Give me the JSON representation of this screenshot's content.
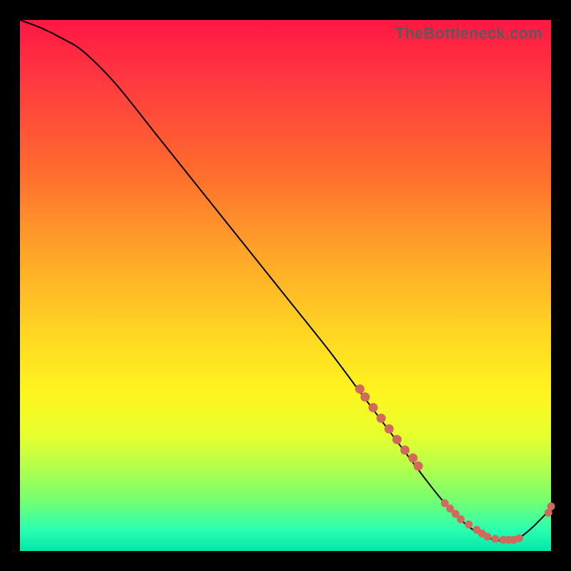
{
  "watermark": "TheBottleneck.com",
  "chart_data": {
    "type": "line",
    "title": "",
    "xlabel": "",
    "ylabel": "",
    "xlim": [
      0,
      100
    ],
    "ylim": [
      0,
      100
    ],
    "series": [
      {
        "name": "curve",
        "x": [
          0,
          4,
          8,
          12,
          18,
          26,
          34,
          42,
          50,
          58,
          64,
          70,
          76,
          80,
          84,
          87,
          90,
          93,
          96,
          100
        ],
        "y": [
          100,
          98.5,
          96.5,
          94,
          88,
          78,
          68,
          58,
          48,
          38,
          30,
          22,
          14,
          9,
          5,
          3,
          2,
          2,
          4,
          8
        ]
      }
    ],
    "scatter_clusters": [
      {
        "name": "cluster-upper",
        "points": [
          [
            64,
            30.5
          ],
          [
            65,
            29
          ],
          [
            66.5,
            27
          ],
          [
            68,
            25
          ],
          [
            69.5,
            23
          ],
          [
            71,
            21
          ],
          [
            72.5,
            19
          ],
          [
            74,
            17.5
          ],
          [
            75,
            16
          ]
        ],
        "radius": 6
      },
      {
        "name": "cluster-bottom",
        "points": [
          [
            80,
            9
          ],
          [
            81,
            8
          ],
          [
            82,
            7
          ],
          [
            83,
            6
          ],
          [
            84.5,
            5
          ],
          [
            86,
            4
          ],
          [
            87,
            3.3
          ],
          [
            88,
            2.7
          ],
          [
            89.5,
            2.3
          ],
          [
            91,
            2.1
          ],
          [
            92,
            2.1
          ],
          [
            93,
            2.1
          ],
          [
            94,
            2.4
          ]
        ],
        "radius": 5
      },
      {
        "name": "cluster-upturn",
        "points": [
          [
            99.5,
            7.2
          ],
          [
            100,
            8.4
          ]
        ],
        "radius": 5
      }
    ]
  }
}
